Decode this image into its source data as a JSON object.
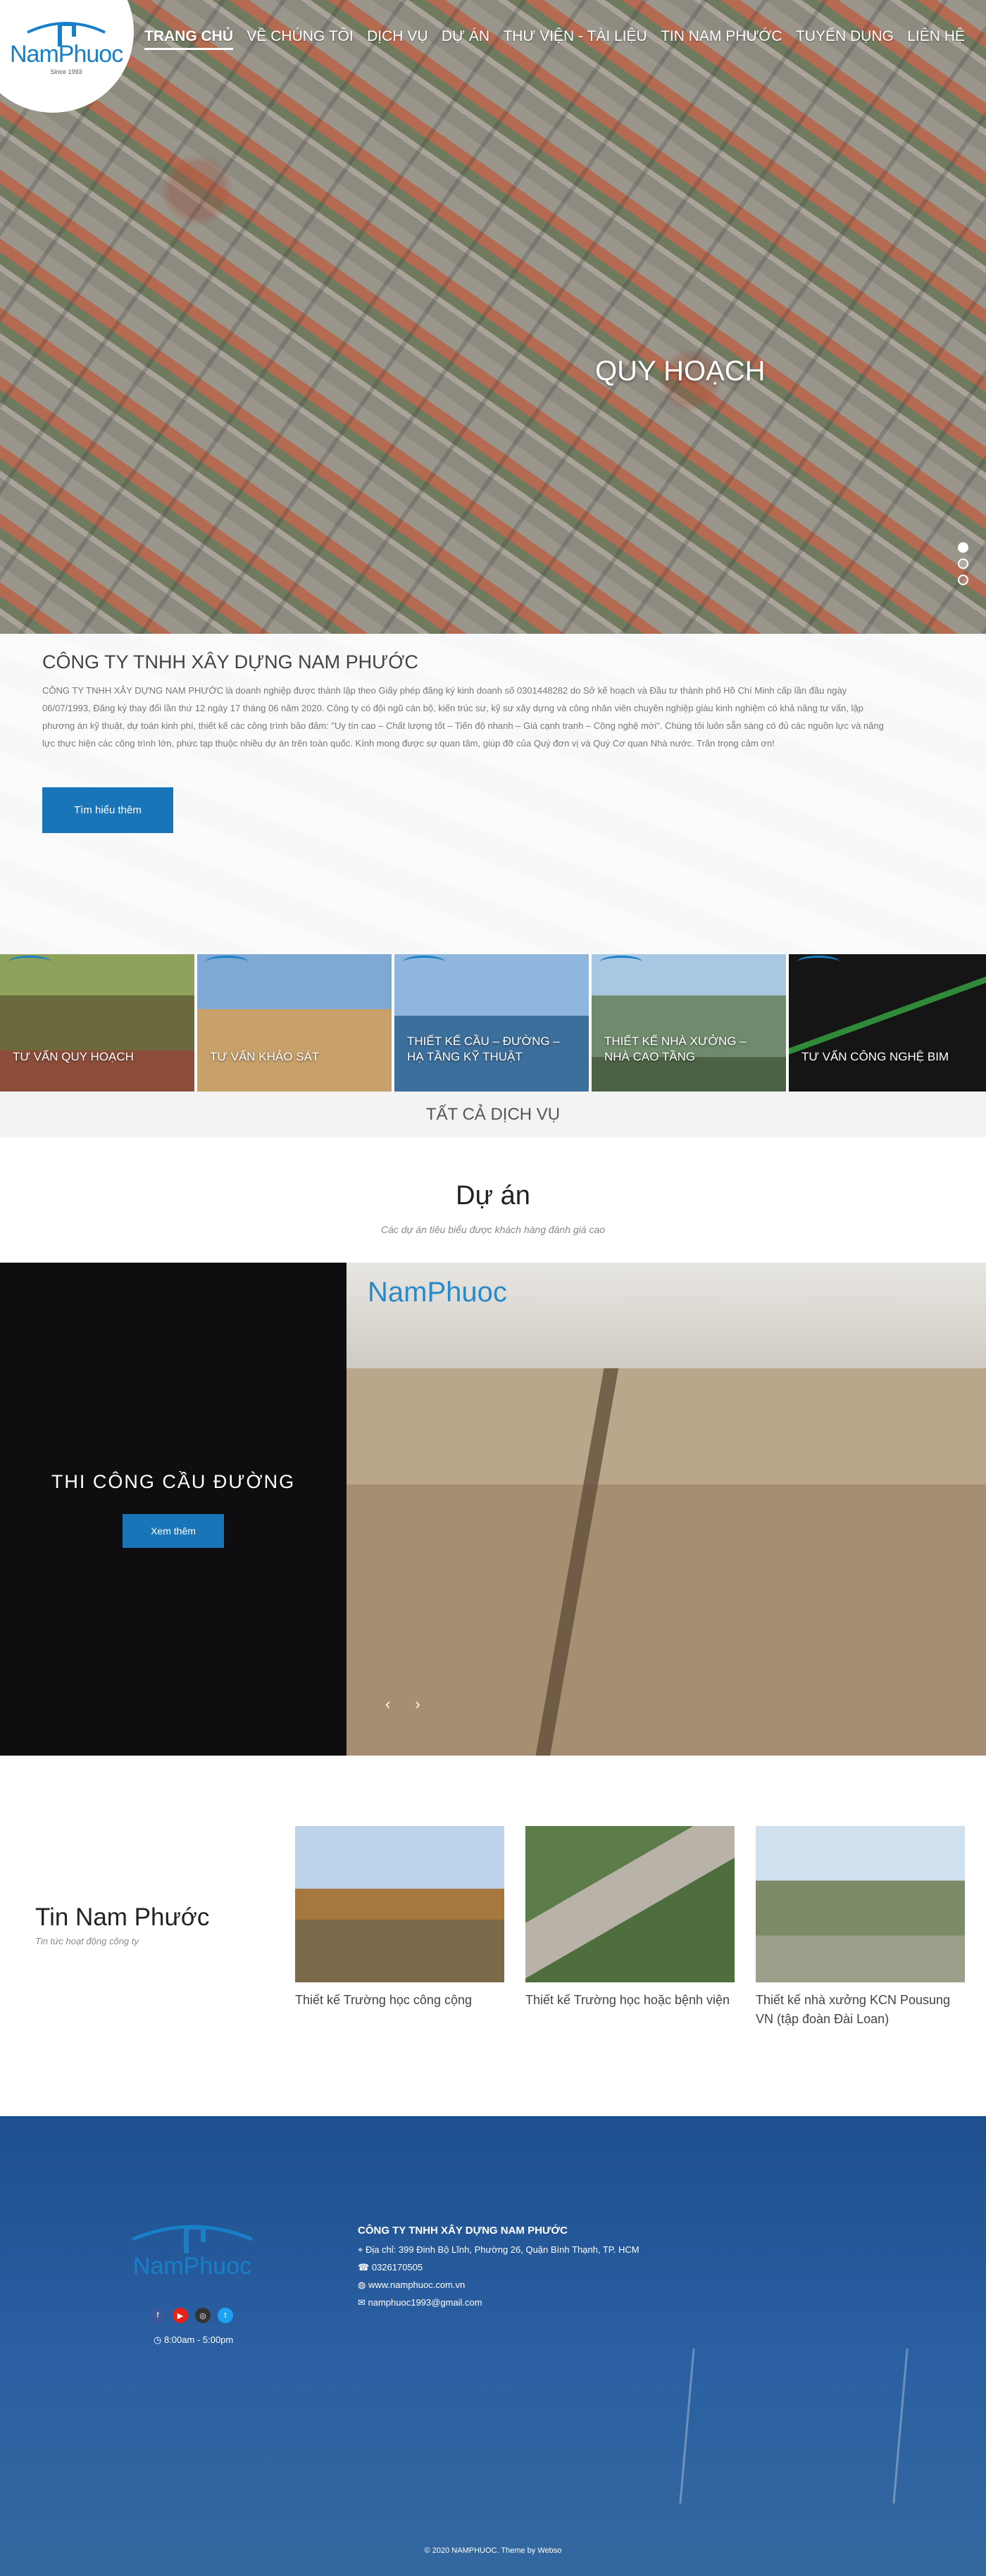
{
  "brand": {
    "name": "NamPhuoc",
    "since": "Since 1993"
  },
  "nav": [
    {
      "label": "Trang chủ",
      "active": true
    },
    {
      "label": "Về chúng tôi"
    },
    {
      "label": "Dịch vụ"
    },
    {
      "label": "Dự án"
    },
    {
      "label": "Thư viện - Tài liệu"
    },
    {
      "label": "Tin Nam Phước"
    },
    {
      "label": "Tuyển dụng"
    },
    {
      "label": "Liên hệ"
    }
  ],
  "hero": {
    "caption": "QUY HOẠCH"
  },
  "about": {
    "title": "CÔNG TY TNHH XÂY DỰNG NAM PHƯỚC",
    "body": "CÔNG TY TNHH XÂY DỰNG NAM PHƯỚC là doanh nghiệp được thành lập theo Giấy phép đăng ký kinh doanh số 0301448282 do Sở kế hoạch và Đầu tư thành phố Hồ Chí Minh cấp lần đầu ngày 06/07/1993, Đăng ký thay đổi lần thứ 12 ngày 17 tháng 06 năm 2020. Công ty có đội ngũ cán bộ, kiến trúc sư, kỹ sư xây dựng và công nhân viên chuyên nghiệp giàu kinh nghiệm có khả năng tư vấn, lập phương án kỹ thuật, dự toán kinh phí, thiết kế các công trình bảo đảm: \"Uy tín cao – Chất lượng tốt – Tiến độ nhanh – Giá cạnh tranh – Công nghệ mới\". Chúng tôi luôn sẵn sàng có đủ các nguồn lực và năng lực thực hiện các công trình lớn, phức tạp thuộc nhiều dự án trên toàn quốc. Kính mong được sự quan tâm, giúp đỡ của Quý đơn vị và Quý Cơ quan Nhà nước. Trân trọng cảm ơn!",
    "button": "Tìm hiểu thêm"
  },
  "services": [
    {
      "label": "TƯ VẤN QUY HOẠCH",
      "bg": "#6b6a3c"
    },
    {
      "label": "TƯ VẤN KHẢO SÁT",
      "bg": "#b08a5c"
    },
    {
      "label": "THIẾT KẾ CẦU – ĐƯỜNG – HẠ TẦNG KỸ THUẬT",
      "bg": "#3d6f9c"
    },
    {
      "label": "THIẾT KẾ NHÀ XƯỞNG – NHÀ CAO TẦNG",
      "bg": "#6f8a6c"
    },
    {
      "label": "TƯ VẤN CÔNG NGHỆ BIM",
      "bg": "#151515"
    }
  ],
  "all_services": "TẤT CẢ DỊCH VỤ",
  "projects": {
    "title": "Dự án",
    "subtitle": "Các dự án tiêu biểu được khách hàng đánh giá cao",
    "featured": "THI CÔNG CẦU ĐƯỜNG",
    "button": "Xem thêm",
    "brand_overlay": "NamPhuoc"
  },
  "news": {
    "title": "Tin Nam Phước",
    "subtitle": "Tin tức hoạt động công ty",
    "items": [
      {
        "caption": "Thiết kế Trường học công cộng",
        "bg": "#8a7a5a"
      },
      {
        "caption": "Thiết kế Trường học hoặc bệnh viện",
        "bg": "#5c7d4a"
      },
      {
        "caption": "Thiết kế nhà xưởng KCN Pousung VN (tập đoàn Đài Loan)",
        "bg": "#7c8a66"
      }
    ]
  },
  "footer": {
    "company": "CÔNG TY TNHH XÂY DỰNG NAM PHƯỚC",
    "address": "Địa chỉ: 399 Đinh Bộ Lĩnh, Phường 26, Quận Bình Thạnh, TP. HCM",
    "phone": "0326170505",
    "website": "www.namphuoc.com.vn",
    "email": "namphuoc1993@gmail.com",
    "hours": "8:00am - 5:00pm",
    "copyright": "© 2020 NAMPHUOC. Theme by Webso",
    "social": [
      {
        "name": "facebook-icon",
        "glyph": "f",
        "color": "#3b5998"
      },
      {
        "name": "youtube-icon",
        "glyph": "▶",
        "color": "#e62117"
      },
      {
        "name": "instagram-icon",
        "glyph": "◎",
        "color": "#333"
      },
      {
        "name": "twitter-icon",
        "glyph": "t",
        "color": "#1da1f2"
      }
    ]
  }
}
